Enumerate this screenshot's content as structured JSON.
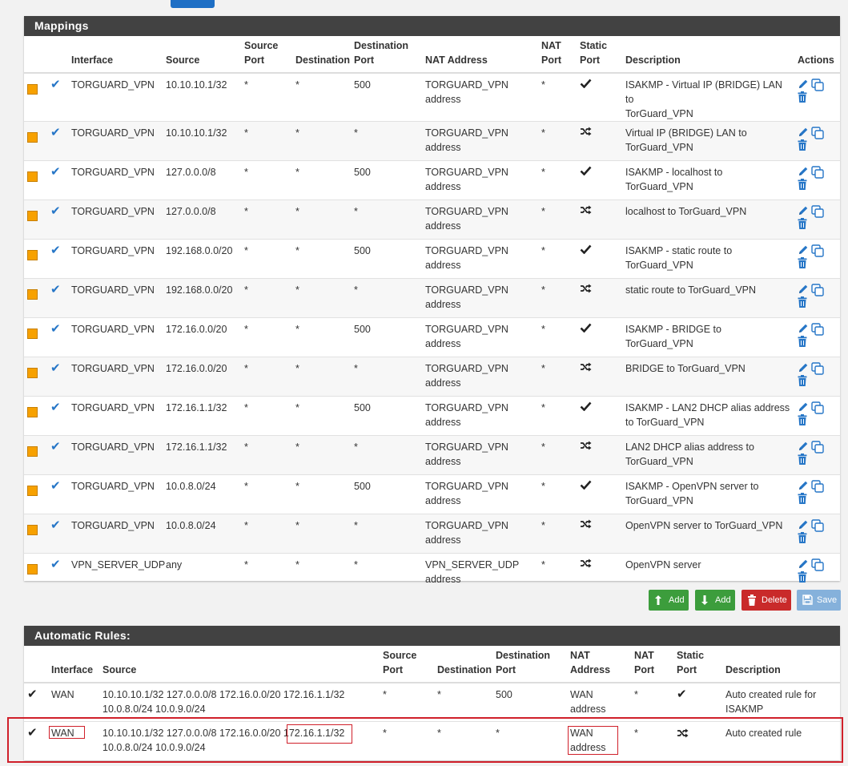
{
  "mappings": {
    "title": "Mappings",
    "headers": {
      "interface": "Interface",
      "source": "Source",
      "source_port_1": "Source",
      "source_port_2": "Port",
      "destination": "Destination",
      "dest_port_1": "Destination",
      "dest_port_2": "Port",
      "nat_address": "NAT Address",
      "nat_port_1": "NAT",
      "nat_port_2": "Port",
      "static_port_1": "Static",
      "static_port_2": "Port",
      "description": "Description",
      "actions": "Actions"
    },
    "rows": [
      {
        "interface": "TORGUARD_VPN",
        "source": "10.10.10.1/32",
        "source_port": "*",
        "destination": "*",
        "dest_port": "500",
        "nat_address_1": "TORGUARD_VPN",
        "nat_address_2": "address",
        "nat_port": "*",
        "static": "check",
        "desc_1": "ISAKMP - Virtual IP (BRIDGE) LAN to",
        "desc_2": "TorGuard_VPN"
      },
      {
        "interface": "TORGUARD_VPN",
        "source": "10.10.10.1/32",
        "source_port": "*",
        "destination": "*",
        "dest_port": "*",
        "nat_address_1": "TORGUARD_VPN",
        "nat_address_2": "address",
        "nat_port": "*",
        "static": "shuffle",
        "desc_1": "Virtual IP (BRIDGE) LAN to",
        "desc_2": "TorGuard_VPN"
      },
      {
        "interface": "TORGUARD_VPN",
        "source": "127.0.0.0/8",
        "source_port": "*",
        "destination": "*",
        "dest_port": "500",
        "nat_address_1": "TORGUARD_VPN",
        "nat_address_2": "address",
        "nat_port": "*",
        "static": "check",
        "desc_1": "ISAKMP - localhost to",
        "desc_2": "TorGuard_VPN"
      },
      {
        "interface": "TORGUARD_VPN",
        "source": "127.0.0.0/8",
        "source_port": "*",
        "destination": "*",
        "dest_port": "*",
        "nat_address_1": "TORGUARD_VPN",
        "nat_address_2": "address",
        "nat_port": "*",
        "static": "shuffle",
        "desc_1": "localhost to TorGuard_VPN",
        "desc_2": ""
      },
      {
        "interface": "TORGUARD_VPN",
        "source": "192.168.0.0/20",
        "source_port": "*",
        "destination": "*",
        "dest_port": "500",
        "nat_address_1": "TORGUARD_VPN",
        "nat_address_2": "address",
        "nat_port": "*",
        "static": "check",
        "desc_1": "ISAKMP - static route to",
        "desc_2": "TorGuard_VPN"
      },
      {
        "interface": "TORGUARD_VPN",
        "source": "192.168.0.0/20",
        "source_port": "*",
        "destination": "*",
        "dest_port": "*",
        "nat_address_1": "TORGUARD_VPN",
        "nat_address_2": "address",
        "nat_port": "*",
        "static": "shuffle",
        "desc_1": "static route to TorGuard_VPN",
        "desc_2": ""
      },
      {
        "interface": "TORGUARD_VPN",
        "source": "172.16.0.0/20",
        "source_port": "*",
        "destination": "*",
        "dest_port": "500",
        "nat_address_1": "TORGUARD_VPN",
        "nat_address_2": "address",
        "nat_port": "*",
        "static": "check",
        "desc_1": "ISAKMP - BRIDGE to TorGuard_VPN",
        "desc_2": ""
      },
      {
        "interface": "TORGUARD_VPN",
        "source": "172.16.0.0/20",
        "source_port": "*",
        "destination": "*",
        "dest_port": "*",
        "nat_address_1": "TORGUARD_VPN",
        "nat_address_2": "address",
        "nat_port": "*",
        "static": "shuffle",
        "desc_1": "BRIDGE to TorGuard_VPN",
        "desc_2": ""
      },
      {
        "interface": "TORGUARD_VPN",
        "source": "172.16.1.1/32",
        "source_port": "*",
        "destination": "*",
        "dest_port": "500",
        "nat_address_1": "TORGUARD_VPN",
        "nat_address_2": "address",
        "nat_port": "*",
        "static": "check",
        "desc_1": "ISAKMP - LAN2 DHCP alias address",
        "desc_2": "to TorGuard_VPN"
      },
      {
        "interface": "TORGUARD_VPN",
        "source": "172.16.1.1/32",
        "source_port": "*",
        "destination": "*",
        "dest_port": "*",
        "nat_address_1": "TORGUARD_VPN",
        "nat_address_2": "address",
        "nat_port": "*",
        "static": "shuffle",
        "desc_1": "LAN2 DHCP alias address to",
        "desc_2": "TorGuard_VPN"
      },
      {
        "interface": "TORGUARD_VPN",
        "source": "10.0.8.0/24",
        "source_port": "*",
        "destination": "*",
        "dest_port": "500",
        "nat_address_1": "TORGUARD_VPN",
        "nat_address_2": "address",
        "nat_port": "*",
        "static": "check",
        "desc_1": "ISAKMP - OpenVPN server to",
        "desc_2": "TorGuard_VPN"
      },
      {
        "interface": "TORGUARD_VPN",
        "source": "10.0.8.0/24",
        "source_port": "*",
        "destination": "*",
        "dest_port": "*",
        "nat_address_1": "TORGUARD_VPN",
        "nat_address_2": "address",
        "nat_port": "*",
        "static": "shuffle",
        "desc_1": "OpenVPN server to TorGuard_VPN",
        "desc_2": ""
      },
      {
        "interface": "VPN_SERVER_UDP",
        "source": "any",
        "source_port": "*",
        "destination": "*",
        "dest_port": "*",
        "nat_address_1": "VPN_SERVER_UDP",
        "nat_address_2": "address",
        "nat_port": "*",
        "static": "shuffle",
        "desc_1": "OpenVPN server",
        "desc_2": ""
      }
    ]
  },
  "buttons": {
    "add_top": "Add",
    "add_bottom": "Add",
    "delete": "Delete",
    "save": "Save"
  },
  "automatic": {
    "title": "Automatic Rules:",
    "headers": {
      "interface": "Interface",
      "source": "Source",
      "source_port_1": "Source",
      "source_port_2": "Port",
      "destination": "Destination",
      "dest_port_1": "Destination",
      "dest_port_2": "Port",
      "nat_address_1": "NAT",
      "nat_address_2": "Address",
      "nat_port_1": "NAT",
      "nat_port_2": "Port",
      "static_port_1": "Static",
      "static_port_2": "Port",
      "description": "Description"
    },
    "rows": [
      {
        "interface": "WAN",
        "source_1": "10.10.10.1/32 127.0.0.0/8 172.16.0.0/20 172.16.1.1/32",
        "source_2": "10.0.8.0/24 10.0.9.0/24",
        "source_port": "*",
        "destination": "*",
        "dest_port": "500",
        "nat_address_1": "WAN",
        "nat_address_2": "address",
        "nat_port": "*",
        "static": "check",
        "desc_1": "Auto created rule for",
        "desc_2": "ISAKMP"
      },
      {
        "interface": "WAN",
        "source_1a": "10.10.10.1/32 127.0.0.0/8 172.16.0.0/20 ",
        "source_1b": "172.16.1.1/32",
        "source_2": "10.0.8.0/24 10.0.9.0/24",
        "source_port": "*",
        "destination": "*",
        "dest_port": "*",
        "nat_address_1": "WAN",
        "nat_address_2": "address",
        "nat_port": "*",
        "static": "shuffle",
        "desc_1": "Auto created rule",
        "desc_2": ""
      }
    ]
  },
  "colors": {
    "header_bg": "#424242",
    "status_square": "#f7a100",
    "check_blue": "#2676c7",
    "btn_green": "#3c9d3c",
    "btn_red": "#c92a2a",
    "btn_save": "#85b1db",
    "highlight": "#d0202a"
  }
}
